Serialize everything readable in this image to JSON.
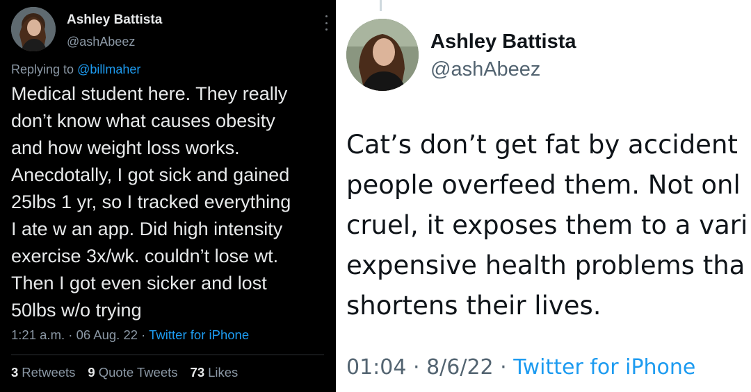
{
  "left_tweet": {
    "author_name": "Ashley Battista",
    "author_handle": "@ashAbeez",
    "replying_prefix": "Replying to",
    "replying_to": "@billmaher",
    "text": "Medical student here. They really\ndon’t know what causes obesity\nand how weight loss works.\nAnecdotally, I got sick and gained\n25lbs 1 yr, so I tracked everything\nI ate w an app. Did high intensity\nexercise 3x/wk. couldn’t lose wt.\nThen I got even sicker and lost\n50lbs w/o trying",
    "timestamp": "1:21 a.m. · 06 Aug. 22 ·",
    "source": "Twitter for iPhone",
    "retweets_count": "3",
    "retweets_label": "Retweets",
    "quotes_count": "9",
    "quotes_label": "Quote Tweets",
    "likes_count": "73",
    "likes_label": "Likes"
  },
  "right_tweet": {
    "author_name": "Ashley Battista",
    "author_handle": "@ashAbeez",
    "text": "Cat’s don’t get fat by accident\npeople overfeed them. Not onl\ncruel, it exposes them to a vari\nexpensive health problems tha\nshortens their lives.",
    "timestamp": "01:04 · 8/6/22 ·",
    "source": "Twitter for iPhone"
  },
  "colors": {
    "dark_bg": "#000000",
    "dark_text": "#e7e9ea",
    "dark_muted": "#8b98a5",
    "light_bg": "#ffffff",
    "light_text": "#0f1419",
    "light_muted": "#536471",
    "link_blue": "#1d9bf0"
  },
  "icons": {
    "more_menu": "more-vertical-icon"
  }
}
